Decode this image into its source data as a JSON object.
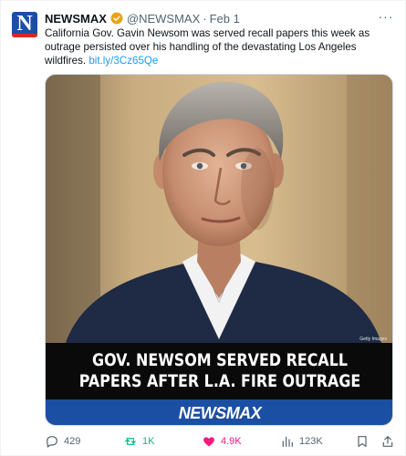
{
  "account": {
    "name": "NEWSMAX",
    "handle": "@NEWSMAX",
    "separator": "·",
    "date": "Feb 1",
    "avatar_letter": "N"
  },
  "tweet": {
    "text": "California Gov. Gavin Newsom was served recall papers this week as outrage persisted over his handling of the devastating Los Angeles wildfires.",
    "link": "bit.ly/3Cz65Qe"
  },
  "media": {
    "photo_credit": "Getty Images",
    "headline_line1": "GOV. NEWSOM SERVED RECALL",
    "headline_line2": "PAPERS AFTER L.A. FIRE OUTRAGE",
    "brand": "NEWSMAX"
  },
  "actions": {
    "replies": "429",
    "reposts": "1K",
    "likes": "4.9K",
    "views": "123K"
  },
  "colors": {
    "accent": "#1d9bf0",
    "repost": "#00ba7c",
    "like": "#f91880",
    "brand_blue": "#1b4fa3"
  },
  "icons": [
    "more-icon",
    "verified-badge-icon",
    "reply-icon",
    "repost-icon",
    "like-icon",
    "views-icon",
    "bookmark-icon",
    "share-icon"
  ]
}
